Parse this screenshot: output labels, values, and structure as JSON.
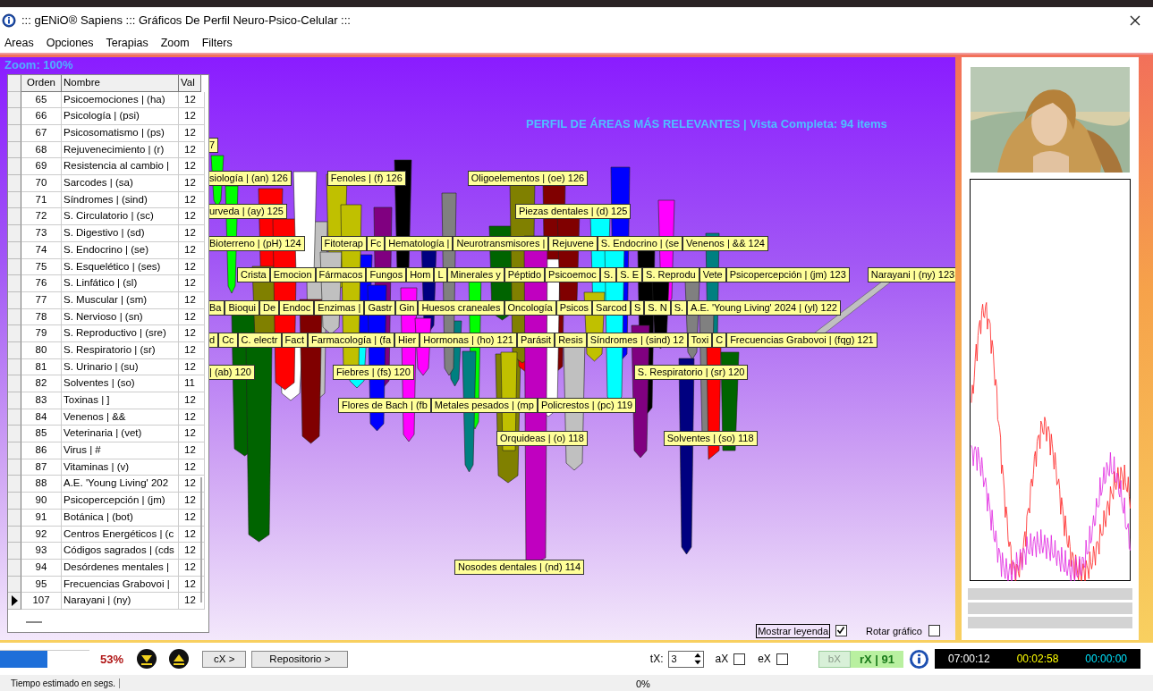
{
  "window": {
    "title": "::: gENiO® Sapiens ::: Gráficos De Perfil Neuro-Psico-Celular :::"
  },
  "menu": [
    "Areas",
    "Opciones",
    "Terapias",
    "Zoom",
    "Filters"
  ],
  "chart": {
    "zoom": "Zoom: 100%",
    "title": "PERFIL DE ÁREAS MÁS RELEVANTES | Vista Completa: 94 items",
    "tiers": [
      {
        "labels": [
          "7"
        ]
      },
      {
        "labels": [
          "siología | (an) 126",
          "Fenoles | (f) 126",
          "Oligoelementos | (oe) 126"
        ]
      },
      {
        "labels": [
          "urveda | (ay) 125",
          "Piezas dentales | (d) 125"
        ]
      },
      {
        "labels": [
          "Bioterreno | (pH) 124",
          "Fitoterap",
          "Fc",
          "Hematología |",
          "Neurotransmisores |",
          "Rejuvene",
          "S. Endocrino | (se",
          "Venenos | && 124"
        ]
      },
      {
        "labels": [
          "Crista",
          "Emocion",
          "Fármacos",
          "Fungos",
          "Hom",
          "L",
          "Minerales y",
          "Péptido",
          "Psicoemoc",
          "S.",
          "S. E",
          "S. Reprodu",
          "Vete",
          "Psicopercepción | (jm) 123",
          "Narayani | (ny) 123"
        ]
      },
      {
        "labels": [
          "Ba",
          "Bioqui",
          "De",
          "Endoc",
          "Enzimas |",
          "Gastr",
          "Gin",
          "Huesos craneales",
          "Oncología",
          "Psicos",
          "Sarcod",
          "S",
          "S. N",
          "S.",
          "A.E. 'Young Living' 2024 | (yl) 122"
        ]
      },
      {
        "labels": [
          "d",
          "Cc",
          "C. electr",
          "Fact",
          "Farmacología | (fa",
          "Hier",
          "Hormonas | (ho) 121",
          "Parásit",
          "Resis",
          "Síndromes | (sind) 12",
          "Toxi",
          "C",
          "Frecuencias Grabovoi | (fqg) 121"
        ]
      },
      {
        "labels": [
          "| (ab) 120",
          "Fiebres | (fs) 120",
          "S. Respiratorio | (sr) 120"
        ]
      },
      {
        "labels": [
          "Flores de Bach | (fb",
          "Metales pesados | (mp",
          "Policrestos | (pc) 119"
        ]
      },
      {
        "labels": [
          "Orquideas | (o) 118",
          "Solventes | (so) 118"
        ]
      },
      {
        "labels": [
          "Nosodes dentales | (nd) 114"
        ]
      }
    ],
    "legend": [
      {
        "label": "Mostrar leyenda",
        "checked": true
      },
      {
        "label": "Rotar gráfico",
        "checked": false
      }
    ]
  },
  "table": {
    "columns": [
      "Orden",
      "Nombre",
      "Val"
    ],
    "rows": [
      {
        "orden": "65",
        "nombre": "Psicoemociones | (ha)",
        "valor": "12",
        "selected": false
      },
      {
        "orden": "66",
        "nombre": "Psicología | (psi)",
        "valor": "12",
        "selected": false
      },
      {
        "orden": "67",
        "nombre": "Psicosomatismo | (ps)",
        "valor": "12",
        "selected": false
      },
      {
        "orden": "68",
        "nombre": "Rejuvenecimiento | (r)",
        "valor": "12",
        "selected": false
      },
      {
        "orden": "69",
        "nombre": "Resistencia al cambio |",
        "valor": "12",
        "selected": false
      },
      {
        "orden": "70",
        "nombre": "Sarcodes | (sa)",
        "valor": "12",
        "selected": false
      },
      {
        "orden": "71",
        "nombre": "Síndromes | (sind)",
        "valor": "12",
        "selected": false
      },
      {
        "orden": "72",
        "nombre": "S. Circulatorio | (sc)",
        "valor": "12",
        "selected": false
      },
      {
        "orden": "73",
        "nombre": "S. Digestivo | (sd)",
        "valor": "12",
        "selected": false
      },
      {
        "orden": "74",
        "nombre": "S. Endocrino | (se)",
        "valor": "12",
        "selected": false
      },
      {
        "orden": "75",
        "nombre": "S. Esquelético | (ses)",
        "valor": "12",
        "selected": false
      },
      {
        "orden": "76",
        "nombre": "S. Linfático | (sl)",
        "valor": "12",
        "selected": false
      },
      {
        "orden": "77",
        "nombre": "S. Muscular | (sm)",
        "valor": "12",
        "selected": false
      },
      {
        "orden": "78",
        "nombre": "S. Nervioso | (sn)",
        "valor": "12",
        "selected": false
      },
      {
        "orden": "79",
        "nombre": "S. Reproductivo | (sre)",
        "valor": "12",
        "selected": false
      },
      {
        "orden": "80",
        "nombre": "S. Respiratorio | (sr)",
        "valor": "12",
        "selected": false
      },
      {
        "orden": "81",
        "nombre": "S. Urinario | (su)",
        "valor": "12",
        "selected": false
      },
      {
        "orden": "82",
        "nombre": "Solventes | (so)",
        "valor": "11",
        "selected": false
      },
      {
        "orden": "83",
        "nombre": "Toxinas | ]",
        "valor": "12",
        "selected": false
      },
      {
        "orden": "84",
        "nombre": "Venenos | &&",
        "valor": "12",
        "selected": false
      },
      {
        "orden": "85",
        "nombre": "Veterinaria | (vet)",
        "valor": "12",
        "selected": false
      },
      {
        "orden": "86",
        "nombre": "Virus | #",
        "valor": "12",
        "selected": false
      },
      {
        "orden": "87",
        "nombre": "Vitaminas | (v)",
        "valor": "12",
        "selected": false
      },
      {
        "orden": "88",
        "nombre": "A.E. 'Young Living' 202",
        "valor": "12",
        "selected": false
      },
      {
        "orden": "90",
        "nombre": "Psicopercepción | (jm)",
        "valor": "12",
        "selected": false
      },
      {
        "orden": "91",
        "nombre": "Botánica | (bot)",
        "valor": "12",
        "selected": false
      },
      {
        "orden": "92",
        "nombre": "Centros Energéticos | (c",
        "valor": "12",
        "selected": false
      },
      {
        "orden": "93",
        "nombre": "Códigos sagrados | (cds",
        "valor": "12",
        "selected": false
      },
      {
        "orden": "94",
        "nombre": "Desórdenes mentales |",
        "valor": "12",
        "selected": false
      },
      {
        "orden": "95",
        "nombre": "Frecuencias Grabovoi |",
        "valor": "12",
        "selected": false
      },
      {
        "orden": "107",
        "nombre": "Narayani | (ny)",
        "valor": "12",
        "selected": true
      }
    ]
  },
  "toolbar": {
    "progress": {
      "level": 0.53
    },
    "percent": "53%",
    "cx": "cX >",
    "repositorio": "Repositorio >",
    "tx_label": "tX:",
    "tx_value": "3",
    "checks": [
      {
        "label": "aX",
        "checked": false
      },
      {
        "label": "eX",
        "checked": false
      }
    ],
    "bx": {
      "label": "bX",
      "disabled": true
    },
    "rx": "rX | 91",
    "times": [
      {
        "text": "07:00:12",
        "color": "#ffffff"
      },
      {
        "text": "00:02:58",
        "color": "#ffff00"
      },
      {
        "text": "00:00:00",
        "color": "#00e5ff"
      }
    ]
  },
  "status_bar": {
    "hint": "Tiempo estimado en segs.",
    "percent": "0%"
  }
}
